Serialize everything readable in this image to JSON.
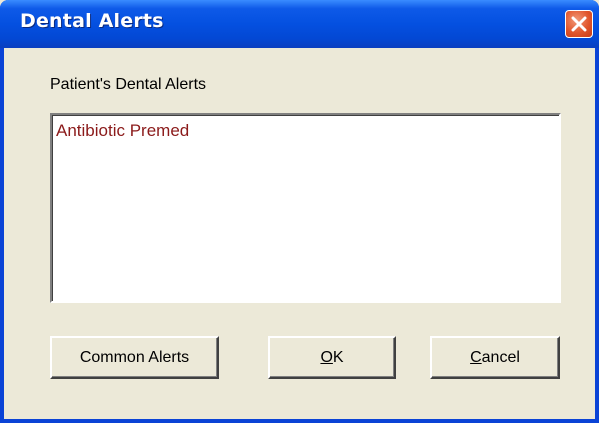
{
  "window": {
    "title": "Dental Alerts"
  },
  "section": {
    "label": "Patient's Dental Alerts"
  },
  "alerts": {
    "items": [
      "Antibiotic Premed"
    ]
  },
  "buttons": {
    "common_alerts": "Common Alerts",
    "ok_accel": "O",
    "ok_rest": "K",
    "cancel_accel": "C",
    "cancel_rest": "ancel"
  },
  "colors": {
    "titlebar": "#0450E0",
    "alert_text": "#8B1A1A",
    "face": "#ECE9D8",
    "close": "#E1562C"
  },
  "icons": {
    "close": "close-icon"
  }
}
